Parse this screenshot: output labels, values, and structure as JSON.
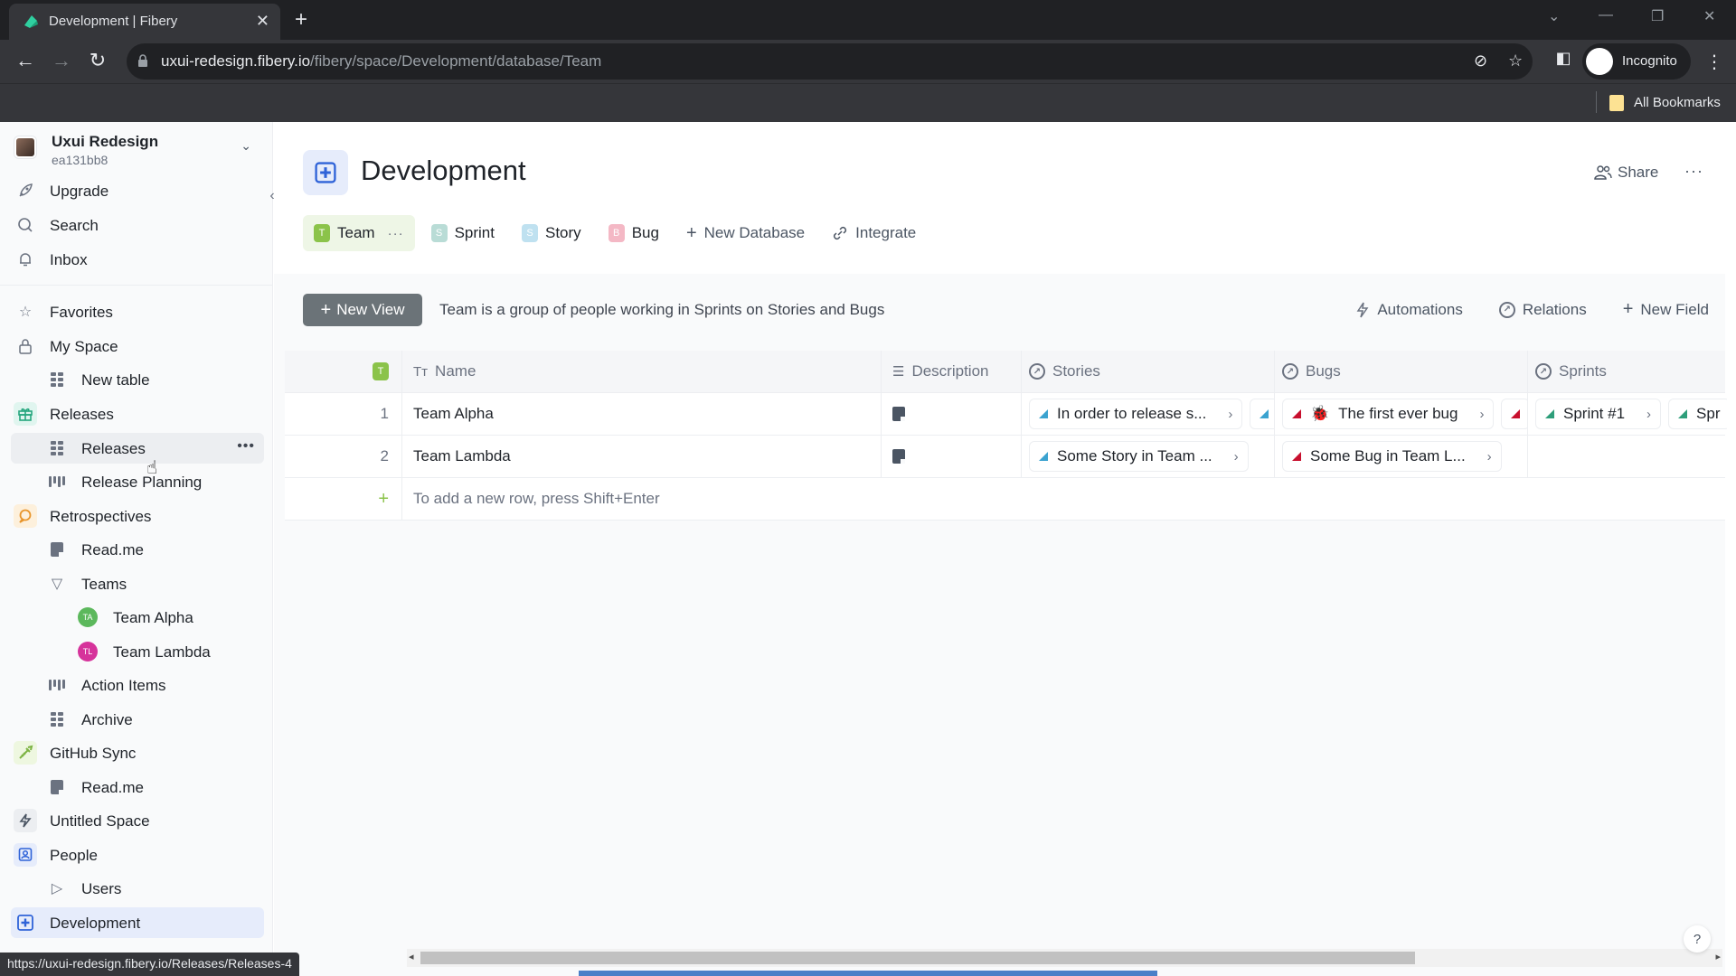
{
  "browser": {
    "tab_title": "Development | Fibery",
    "url_domain": "uxui-redesign.fibery.io",
    "url_path": "/fibery/space/Development/database/Team",
    "profile_label": "Incognito",
    "bookmarks_label": "All Bookmarks",
    "status_url": "https://uxui-redesign.fibery.io/Releases/Releases-4"
  },
  "workspace": {
    "name": "Uxui Redesign",
    "id": "ea131bb8"
  },
  "sidebar": {
    "top_items": [
      {
        "label": "Upgrade",
        "icon": "rocket-icon"
      },
      {
        "label": "Search",
        "icon": "search-icon"
      },
      {
        "label": "Inbox",
        "icon": "bell-icon"
      }
    ],
    "items": [
      {
        "label": "Favorites",
        "icon": "star-icon"
      },
      {
        "label": "My Space",
        "icon": "lock-icon"
      },
      {
        "label": "New table",
        "icon": "table-icon"
      },
      {
        "label": "Releases",
        "icon": "gift-icon"
      },
      {
        "label": "Releases",
        "icon": "table-icon"
      },
      {
        "label": "Release Planning",
        "icon": "board-icon"
      },
      {
        "label": "Retrospectives",
        "icon": "chat-icon"
      },
      {
        "label": "Read.me",
        "icon": "document-icon"
      },
      {
        "label": "Teams",
        "icon": "triangle-down-icon"
      },
      {
        "label": "Team Alpha",
        "initials": "TA",
        "color": "#5cb85c"
      },
      {
        "label": "Team Lambda",
        "initials": "TL",
        "color": "#d6339b"
      },
      {
        "label": "Action Items",
        "icon": "board-icon"
      },
      {
        "label": "Archive",
        "icon": "table-icon"
      },
      {
        "label": "GitHub Sync",
        "icon": "screw-icon"
      },
      {
        "label": "Read.me",
        "icon": "document-icon"
      },
      {
        "label": "Untitled Space",
        "icon": "lightning-icon"
      },
      {
        "label": "People",
        "icon": "person-badge-icon"
      },
      {
        "label": "Users",
        "icon": "triangle-right-icon"
      },
      {
        "label": "Development",
        "icon": "development-icon"
      }
    ],
    "more_label": "•••"
  },
  "page": {
    "title": "Development",
    "share_label": "Share",
    "more_label": "···",
    "db_tabs": [
      {
        "label": "Team",
        "badge": "T",
        "color": "#8bc34a",
        "active": true
      },
      {
        "label": "Sprint",
        "badge": "S",
        "color": "#b9dcd6"
      },
      {
        "label": "Story",
        "badge": "S",
        "color": "#bfe1f0"
      },
      {
        "label": "Bug",
        "badge": "B",
        "color": "#f4b8c5"
      }
    ],
    "new_database_label": "New Database",
    "integrate_label": "Integrate",
    "tab_more": "···"
  },
  "toolbar": {
    "new_view_label": "New View",
    "description": "Team is a group of people working in Sprints on Stories and Bugs",
    "automations_label": "Automations",
    "relations_label": "Relations",
    "new_field_label": "New Field"
  },
  "table": {
    "type_badge": "T",
    "columns": [
      "Name",
      "Description",
      "Stories",
      "Bugs",
      "Sprints"
    ],
    "rows": [
      {
        "num": "1",
        "name": "Team Alpha",
        "stories": [
          "In order to release s..."
        ],
        "stories_overflow": true,
        "bugs": [
          "The first ever bug"
        ],
        "bugs_has_emoji": true,
        "bugs_overflow": true,
        "sprints": [
          "Sprint #1",
          "Spr"
        ]
      },
      {
        "num": "2",
        "name": "Team Lambda",
        "stories": [
          "Some Story in Team ..."
        ],
        "bugs": [
          "Some Bug in Team L..."
        ],
        "sprints": []
      }
    ],
    "add_row_hint": "To add a new row, press Shift+Enter",
    "colors": {
      "story": "#3ba3d0",
      "bug": "#c8102e",
      "sprint": "#2e9e7a"
    }
  },
  "help_label": "?"
}
